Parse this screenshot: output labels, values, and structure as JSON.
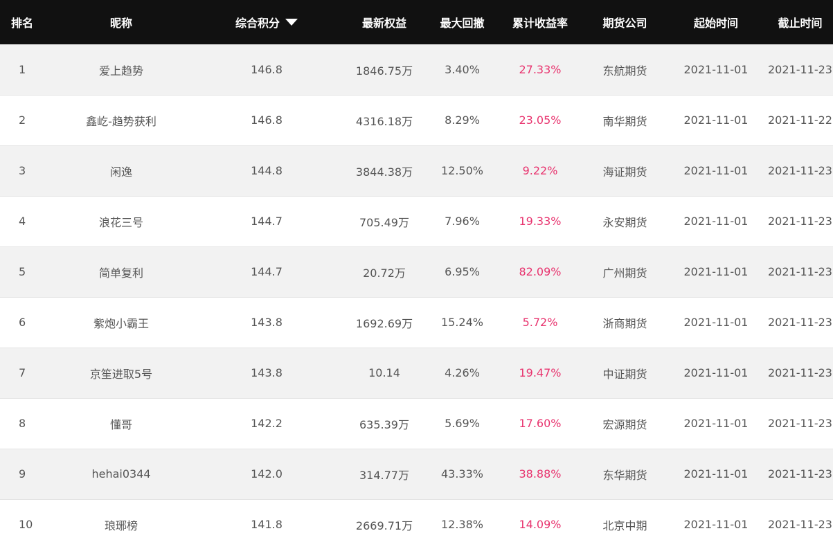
{
  "header": {
    "rank": "排名",
    "nickname": "昵称",
    "score": "综合积分",
    "equity": "最新权益",
    "drawdown": "最大回撤",
    "return_rate": "累计收益率",
    "company": "期货公司",
    "start": "起始时间",
    "end": "截止时间"
  },
  "sort": {
    "column": "score",
    "direction": "desc",
    "icon": "triangle-down-icon"
  },
  "colors": {
    "header_bg": "#111111",
    "row_alt_bg": "#f2f2f2",
    "rate_color": "#e8336e",
    "text_color": "#555555"
  },
  "rows": [
    {
      "rank": "1",
      "nickname": "爱上趋势",
      "score": "146.8",
      "equity": "1846.75万",
      "drawdown": "3.40%",
      "return_rate": "27.33%",
      "company": "东航期货",
      "start": "2021-11-01",
      "end": "2021-11-23"
    },
    {
      "rank": "2",
      "nickname": "鑫屹-趋势获利",
      "score": "146.8",
      "equity": "4316.18万",
      "drawdown": "8.29%",
      "return_rate": "23.05%",
      "company": "南华期货",
      "start": "2021-11-01",
      "end": "2021-11-22"
    },
    {
      "rank": "3",
      "nickname": "闲逸",
      "score": "144.8",
      "equity": "3844.38万",
      "drawdown": "12.50%",
      "return_rate": "9.22%",
      "company": "海证期货",
      "start": "2021-11-01",
      "end": "2021-11-23"
    },
    {
      "rank": "4",
      "nickname": "浪花三号",
      "score": "144.7",
      "equity": "705.49万",
      "drawdown": "7.96%",
      "return_rate": "19.33%",
      "company": "永安期货",
      "start": "2021-11-01",
      "end": "2021-11-23"
    },
    {
      "rank": "5",
      "nickname": "简单复利",
      "score": "144.7",
      "equity": "20.72万",
      "drawdown": "6.95%",
      "return_rate": "82.09%",
      "company": "广州期货",
      "start": "2021-11-01",
      "end": "2021-11-23"
    },
    {
      "rank": "6",
      "nickname": "紫炮小霸王",
      "score": "143.8",
      "equity": "1692.69万",
      "drawdown": "15.24%",
      "return_rate": "5.72%",
      "company": "浙商期货",
      "start": "2021-11-01",
      "end": "2021-11-23"
    },
    {
      "rank": "7",
      "nickname": "京笙进取5号",
      "score": "143.8",
      "equity": "10.14",
      "drawdown": "4.26%",
      "return_rate": "19.47%",
      "company": "中证期货",
      "start": "2021-11-01",
      "end": "2021-11-23"
    },
    {
      "rank": "8",
      "nickname": "懂哥",
      "score": "142.2",
      "equity": "635.39万",
      "drawdown": "5.69%",
      "return_rate": "17.60%",
      "company": "宏源期货",
      "start": "2021-11-01",
      "end": "2021-11-23"
    },
    {
      "rank": "9",
      "nickname": "hehai0344",
      "score": "142.0",
      "equity": "314.77万",
      "drawdown": "43.33%",
      "return_rate": "38.88%",
      "company": "东华期货",
      "start": "2021-11-01",
      "end": "2021-11-23"
    },
    {
      "rank": "10",
      "nickname": "琅琊榜",
      "score": "141.8",
      "equity": "2669.71万",
      "drawdown": "12.38%",
      "return_rate": "14.09%",
      "company": "北京中期",
      "start": "2021-11-01",
      "end": "2021-11-23"
    }
  ]
}
